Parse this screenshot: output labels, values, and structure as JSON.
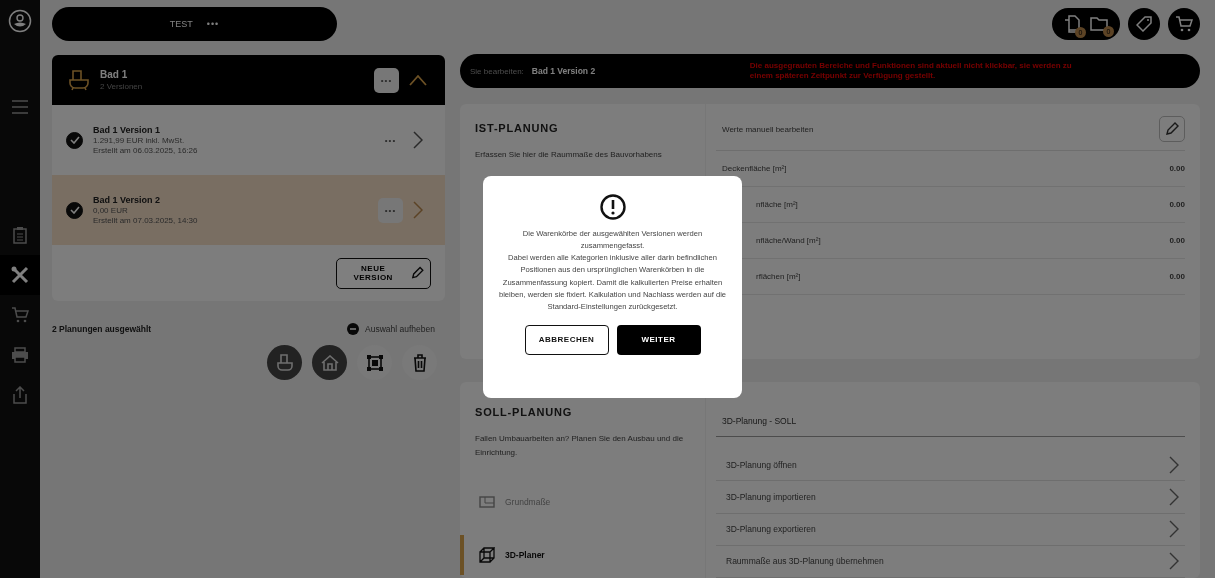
{
  "sidebar": {
    "items": [
      {
        "selected": false
      },
      {
        "selected": false
      },
      {
        "selected": true
      },
      {
        "selected": false
      },
      {
        "selected": false
      },
      {
        "selected": false
      }
    ]
  },
  "project_bar": {
    "title": "TEST",
    "more": "•••"
  },
  "top_actions": {
    "badges": [
      {
        "count": "0"
      },
      {
        "count": "0"
      }
    ]
  },
  "group": {
    "title": "Bad 1",
    "subtitle": "2 Versionen",
    "more": "•••",
    "expanded": true
  },
  "versions": [
    {
      "title": "Bad 1 Version 1",
      "price": "1.291,99 EUR inkl. MwSt.",
      "created": "Erstellt am 06.03.2025, 16:26",
      "more": "•••",
      "checked": true,
      "selected": false
    },
    {
      "title": "Bad 1 Version 2",
      "price": "0,00 EUR",
      "created": "Erstellt am 07.03.2025, 14:30",
      "more": "•••",
      "checked": true,
      "selected": true
    }
  ],
  "new_version": "NEUE VERSION",
  "selection": {
    "count_label": "2 Planungen ausgewählt",
    "clear": "Auswahl aufheben"
  },
  "selection_actions": [
    {
      "active": true
    },
    {
      "active": true
    },
    {
      "active": false
    },
    {
      "active": false
    }
  ],
  "banner": {
    "label": "Sie bearbeiten:",
    "value": "Bad 1 Version 2",
    "warning": "Die ausgegrauten Bereiche und Funktionen sind aktuell nicht klickbar, sie werden zu einem späteren Zeitpunkt zur Verfügung gestellt."
  },
  "ist": {
    "title": "IST-PLANUNG",
    "description": "Erfassen Sie hier die Raummaße des Bauvorhabens",
    "edit_label": "Werte manuell bearbeiten",
    "rows": [
      {
        "label": "Deckenfläche [m²]",
        "value": "0.00",
        "kind": "full"
      },
      {
        "label": "nfläche [m²]",
        "value": "0.00",
        "kind": "cut"
      },
      {
        "label": "nfläche/Wand [m²]",
        "value": "0.00",
        "kind": "cut"
      },
      {
        "label": "rflächen [m²]",
        "value": "0.00",
        "kind": "cut"
      }
    ]
  },
  "soll": {
    "title": "SOLL-PLANUNG",
    "description": "Fallen Umbauarbeiten an? Planen Sie den Ausbau und die Einrichtung.",
    "nav": [
      {
        "label": "Grundmaße",
        "disabled": true,
        "selected": false
      },
      {
        "label": "3D-Planer",
        "disabled": false,
        "selected": true
      }
    ],
    "panel_title": "3D-Planung - SOLL",
    "actions": [
      "3D-Planung öffnen",
      "3D-Planung importieren",
      "3D-Planung exportieren",
      "Raummaße aus 3D-Planung übernehmen"
    ]
  },
  "dialog": {
    "paragraphs": [
      "Die Warenkörbe der ausgewählten Versionen werden zusammengefasst.",
      "Dabei werden alle Kategorien inklusive aller darin befindlichen Positionen aus den ursprünglichen Warenkörben in die Zusammenfassung kopiert. Damit die kalkulierten Preise erhalten bleiben, werden sie fixiert. Kalkulation und Nachlass werden auf die Standard-Einstellungen zurückgesetzt."
    ],
    "cancel": "ABBRECHEN",
    "confirm": "WEITER"
  }
}
